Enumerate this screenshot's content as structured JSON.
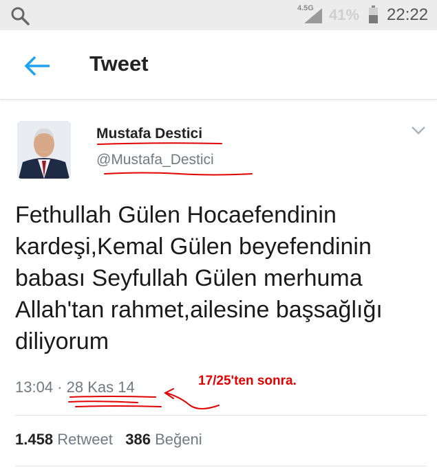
{
  "status_bar": {
    "network": "4.5G",
    "battery_percent": "41%",
    "time": "22:22"
  },
  "app_bar": {
    "title": "Tweet"
  },
  "tweet": {
    "author_name": "Mustafa Destici",
    "author_handle": "@Mustafa_Destici",
    "text": "Fethullah Gülen Hocaefendinin kardeşi,Kemal Gülen beyefendinin babası Seyfullah Gülen merhuma Allah'tan rahmet,ailesine başsağlığı diliyorum",
    "time": "13:04",
    "separator": " · ",
    "date": "28 Kas 14",
    "retweet_count": "1.458",
    "retweet_label": "Retweet",
    "like_count": "386",
    "like_label": "Beğeni"
  },
  "annotation": {
    "note": "17/25'ten sonra.",
    "color": "#e00000"
  },
  "colors": {
    "accent": "#1da1f2",
    "secondary_text": "#707a83",
    "primary_text": "#222222"
  }
}
